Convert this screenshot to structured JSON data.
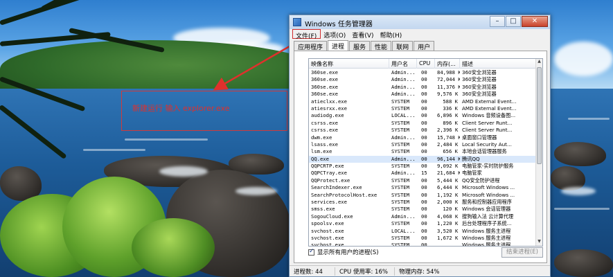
{
  "annotation": {
    "text": "新建运行 输入 explorer.exe",
    "color": "#e0302c"
  },
  "window": {
    "title": "Windows 任务管理器",
    "buttons": {
      "minimize": "–",
      "maximize": "□",
      "close": "✕"
    }
  },
  "menubar": {
    "items": [
      "文件(F)",
      "选项(O)",
      "查看(V)",
      "帮助(H)"
    ]
  },
  "tabs": {
    "items": [
      "应用程序",
      "进程",
      "服务",
      "性能",
      "联网",
      "用户"
    ],
    "active": "进程"
  },
  "processes": {
    "columns": {
      "name": "映像名称",
      "user": "用户名",
      "cpu": "CPU",
      "mem": "内存(...",
      "desc": "描述"
    },
    "rows": [
      {
        "name": "360se.exe",
        "user": "Admin...",
        "cpu": "00",
        "mem": "84,988 K",
        "desc": "360安全浏览器"
      },
      {
        "name": "360se.exe",
        "user": "Admin...",
        "cpu": "00",
        "mem": "72,044 K",
        "desc": "360安全浏览器"
      },
      {
        "name": "360se.exe",
        "user": "Admin...",
        "cpu": "00",
        "mem": "11,376 K",
        "desc": "360安全浏览器"
      },
      {
        "name": "360se.exe",
        "user": "Admin...",
        "cpu": "00",
        "mem": "9,576 K",
        "desc": "360安全浏览器"
      },
      {
        "name": "atieclxx.exe",
        "user": "SYSTEM",
        "cpu": "00",
        "mem": "588 K",
        "desc": "AMD External Event..."
      },
      {
        "name": "atiesrxx.exe",
        "user": "SYSTEM",
        "cpu": "00",
        "mem": "336 K",
        "desc": "AMD External Event..."
      },
      {
        "name": "audiodg.exe",
        "user": "LOCAL...",
        "cpu": "00",
        "mem": "6,896 K",
        "desc": "Windows 音频设备图..."
      },
      {
        "name": "csrss.exe",
        "user": "SYSTEM",
        "cpu": "00",
        "mem": "896 K",
        "desc": "Client Server Runt..."
      },
      {
        "name": "csrss.exe",
        "user": "SYSTEM",
        "cpu": "00",
        "mem": "2,396 K",
        "desc": "Client Server Runt..."
      },
      {
        "name": "dwm.exe",
        "user": "Admin...",
        "cpu": "00",
        "mem": "15,748 K",
        "desc": "桌面窗口管理器"
      },
      {
        "name": "lsass.exe",
        "user": "SYSTEM",
        "cpu": "00",
        "mem": "2,484 K",
        "desc": "Local Security Aut..."
      },
      {
        "name": "lsm.exe",
        "user": "SYSTEM",
        "cpu": "00",
        "mem": "656 K",
        "desc": "本地会话管理器服务"
      },
      {
        "name": "QQ.exe",
        "user": "Admin...",
        "cpu": "00",
        "mem": "96,144 K",
        "desc": "腾讯QQ"
      },
      {
        "name": "QQPCRTP.exe",
        "user": "SYSTEM",
        "cpu": "00",
        "mem": "9,092 K",
        "desc": "电脑管家-实时防护服务"
      },
      {
        "name": "QQPCTray.exe",
        "user": "Admin...",
        "cpu": "15",
        "mem": "21,684 K",
        "desc": "电脑管家"
      },
      {
        "name": "QQProtect.exe",
        "user": "SYSTEM",
        "cpu": "00",
        "mem": "5,444 K",
        "desc": "QQ安全防护进程"
      },
      {
        "name": "SearchIndexer.exe",
        "user": "SYSTEM",
        "cpu": "00",
        "mem": "6,444 K",
        "desc": "Microsoft Windows ..."
      },
      {
        "name": "SearchProtocolHost.exe",
        "user": "SYSTEM",
        "cpu": "00",
        "mem": "1,192 K",
        "desc": "Microsoft Windows ..."
      },
      {
        "name": "services.exe",
        "user": "SYSTEM",
        "cpu": "00",
        "mem": "2,000 K",
        "desc": "服务和控制器应用程序"
      },
      {
        "name": "smss.exe",
        "user": "SYSTEM",
        "cpu": "00",
        "mem": "120 K",
        "desc": "Windows 会话管理器"
      },
      {
        "name": "SogouCloud.exe",
        "user": "Admin...",
        "cpu": "00",
        "mem": "4,068 K",
        "desc": "搜狗输入法 云计算代理"
      },
      {
        "name": "spoolsv.exe",
        "user": "SYSTEM",
        "cpu": "00",
        "mem": "1,220 K",
        "desc": "后台处理程序子系统..."
      },
      {
        "name": "svchost.exe",
        "user": "LOCAL...",
        "cpu": "00",
        "mem": "3,520 K",
        "desc": "Windows 服务主进程"
      },
      {
        "name": "svchost.exe",
        "user": "SYSTEM",
        "cpu": "00",
        "mem": "1,672 K",
        "desc": "Windows 服务主进程"
      },
      {
        "name": "svchost.exe",
        "user": "SYSTEM",
        "cpu": "00",
        "mem": "",
        "desc": "Windows 服务主进程"
      }
    ],
    "selected_row": "QQ.exe"
  },
  "controls": {
    "show_all_label": "显示所有用户的进程(S)",
    "show_all_checked": true,
    "end_process_label": "结束进程(E)"
  },
  "status": {
    "processes": "进程数: 44",
    "cpu": "CPU 使用率: 16%",
    "memory": "物理内存: 54%"
  }
}
